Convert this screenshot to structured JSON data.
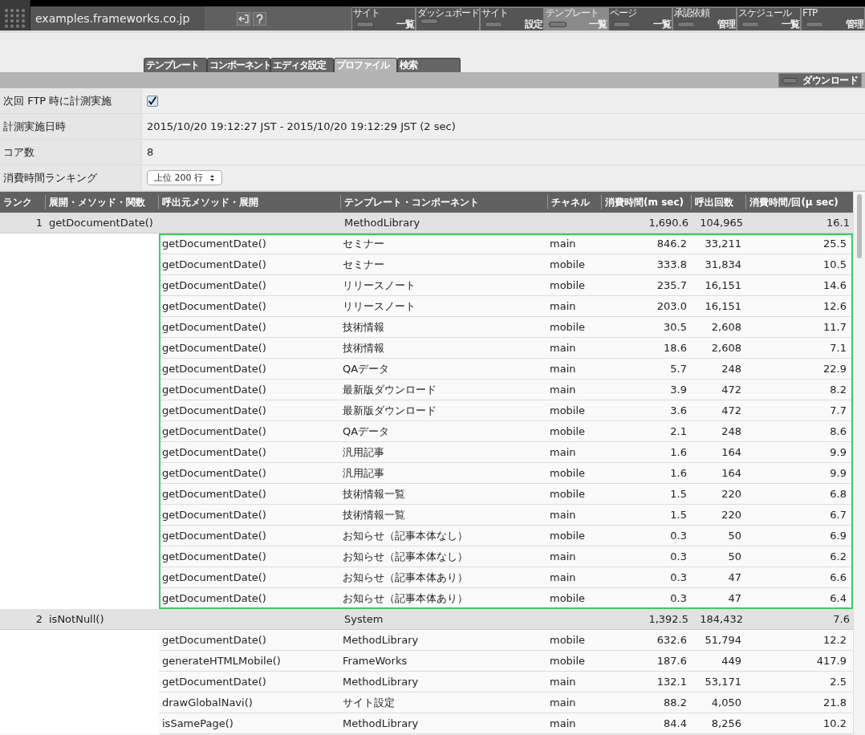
{
  "header": {
    "site": "examples.frameworks.co.jp"
  },
  "nav": [
    {
      "top": "サイト",
      "bottom": "一覧",
      "selected": false
    },
    {
      "top": "ダッシュボード",
      "selected": false
    },
    {
      "top": "サイト",
      "bottom": "設定",
      "selected": false
    },
    {
      "top": "テンプレート",
      "bottom": "一覧",
      "selected": true
    },
    {
      "top": "ページ",
      "bottom": "一覧",
      "selected": false
    },
    {
      "top": "承認依頼",
      "bottom": "管理",
      "selected": false
    },
    {
      "top": "スケジュール",
      "bottom": "一覧",
      "selected": false
    },
    {
      "top": "FTP",
      "bottom": "管理",
      "selected": false
    }
  ],
  "tabs": [
    {
      "label": "テンプレート",
      "selected": false
    },
    {
      "label": "コンポーネント",
      "selected": false
    },
    {
      "label": "エディタ設定",
      "selected": false
    },
    {
      "label": "プロファイル",
      "selected": true
    },
    {
      "label": "検索",
      "selected": false
    }
  ],
  "download_button": "ダウンロード",
  "settings": [
    {
      "kind": "checkbox",
      "label": "次回 FTP 時に計測実施",
      "checked": true
    },
    {
      "kind": "text",
      "label": "計測実施日時",
      "value": "2015/10/20 19:12:27 JST - 2015/10/20 19:12:29 JST (2 sec)"
    },
    {
      "kind": "text",
      "label": "コア数",
      "value": "8"
    },
    {
      "kind": "select",
      "label": "消費時間ランキング",
      "value": "上位 200 行"
    }
  ],
  "table": {
    "columns": [
      "ランク",
      "展開・メソッド・関数",
      "呼出元メソッド・展開",
      "テンプレート・コンポーネント",
      "チャネル",
      "消費時間(m sec)",
      "呼出回数",
      "消費時間/回(μ sec)"
    ],
    "groups": [
      {
        "rank": "1",
        "method": "getDocumentDate()",
        "template": "MethodLibrary",
        "time": "1,690.6",
        "calls": "104,965",
        "per_call": "16.1",
        "highlighted": true,
        "children": [
          {
            "caller": "getDocumentDate()",
            "template": "セミナー",
            "channel": "main",
            "time": "846.2",
            "calls": "33,211",
            "per_call": "25.5"
          },
          {
            "caller": "getDocumentDate()",
            "template": "セミナー",
            "channel": "mobile",
            "time": "333.8",
            "calls": "31,834",
            "per_call": "10.5"
          },
          {
            "caller": "getDocumentDate()",
            "template": "リリースノート",
            "channel": "mobile",
            "time": "235.7",
            "calls": "16,151",
            "per_call": "14.6"
          },
          {
            "caller": "getDocumentDate()",
            "template": "リリースノート",
            "channel": "main",
            "time": "203.0",
            "calls": "16,151",
            "per_call": "12.6"
          },
          {
            "caller": "getDocumentDate()",
            "template": "技術情報",
            "channel": "mobile",
            "time": "30.5",
            "calls": "2,608",
            "per_call": "11.7"
          },
          {
            "caller": "getDocumentDate()",
            "template": "技術情報",
            "channel": "main",
            "time": "18.6",
            "calls": "2,608",
            "per_call": "7.1"
          },
          {
            "caller": "getDocumentDate()",
            "template": "QAデータ",
            "channel": "main",
            "time": "5.7",
            "calls": "248",
            "per_call": "22.9"
          },
          {
            "caller": "getDocumentDate()",
            "template": "最新版ダウンロード",
            "channel": "main",
            "time": "3.9",
            "calls": "472",
            "per_call": "8.2"
          },
          {
            "caller": "getDocumentDate()",
            "template": "最新版ダウンロード",
            "channel": "mobile",
            "time": "3.6",
            "calls": "472",
            "per_call": "7.7"
          },
          {
            "caller": "getDocumentDate()",
            "template": "QAデータ",
            "channel": "mobile",
            "time": "2.1",
            "calls": "248",
            "per_call": "8.6"
          },
          {
            "caller": "getDocumentDate()",
            "template": "汎用記事",
            "channel": "main",
            "time": "1.6",
            "calls": "164",
            "per_call": "9.9"
          },
          {
            "caller": "getDocumentDate()",
            "template": "汎用記事",
            "channel": "mobile",
            "time": "1.6",
            "calls": "164",
            "per_call": "9.9"
          },
          {
            "caller": "getDocumentDate()",
            "template": "技術情報一覧",
            "channel": "mobile",
            "time": "1.5",
            "calls": "220",
            "per_call": "6.8"
          },
          {
            "caller": "getDocumentDate()",
            "template": "技術情報一覧",
            "channel": "main",
            "time": "1.5",
            "calls": "220",
            "per_call": "6.7"
          },
          {
            "caller": "getDocumentDate()",
            "template": "お知らせ（記事本体なし）",
            "channel": "mobile",
            "time": "0.3",
            "calls": "50",
            "per_call": "6.9"
          },
          {
            "caller": "getDocumentDate()",
            "template": "お知らせ（記事本体なし）",
            "channel": "main",
            "time": "0.3",
            "calls": "50",
            "per_call": "6.2"
          },
          {
            "caller": "getDocumentDate()",
            "template": "お知らせ（記事本体あり）",
            "channel": "main",
            "time": "0.3",
            "calls": "47",
            "per_call": "6.6"
          },
          {
            "caller": "getDocumentDate()",
            "template": "お知らせ（記事本体あり）",
            "channel": "mobile",
            "time": "0.3",
            "calls": "47",
            "per_call": "6.4"
          }
        ]
      },
      {
        "rank": "2",
        "method": "isNotNull()",
        "template": "System",
        "time": "1,392.5",
        "calls": "184,432",
        "per_call": "7.6",
        "highlighted": false,
        "children": [
          {
            "caller": "getDocumentDate()",
            "template": "MethodLibrary",
            "channel": "mobile",
            "time": "632.6",
            "calls": "51,794",
            "per_call": "12.2"
          },
          {
            "caller": "generateHTMLMobile()",
            "template": "FrameWorks",
            "channel": "mobile",
            "time": "187.6",
            "calls": "449",
            "per_call": "417.9"
          },
          {
            "caller": "getDocumentDate()",
            "template": "MethodLibrary",
            "channel": "main",
            "time": "132.1",
            "calls": "53,171",
            "per_call": "2.5"
          },
          {
            "caller": "drawGlobalNavi()",
            "template": "サイト設定",
            "channel": "main",
            "time": "88.2",
            "calls": "4,050",
            "per_call": "21.8"
          },
          {
            "caller": "isSamePage()",
            "template": "MethodLibrary",
            "channel": "main",
            "time": "84.4",
            "calls": "8,256",
            "per_call": "10.2"
          }
        ]
      }
    ]
  }
}
